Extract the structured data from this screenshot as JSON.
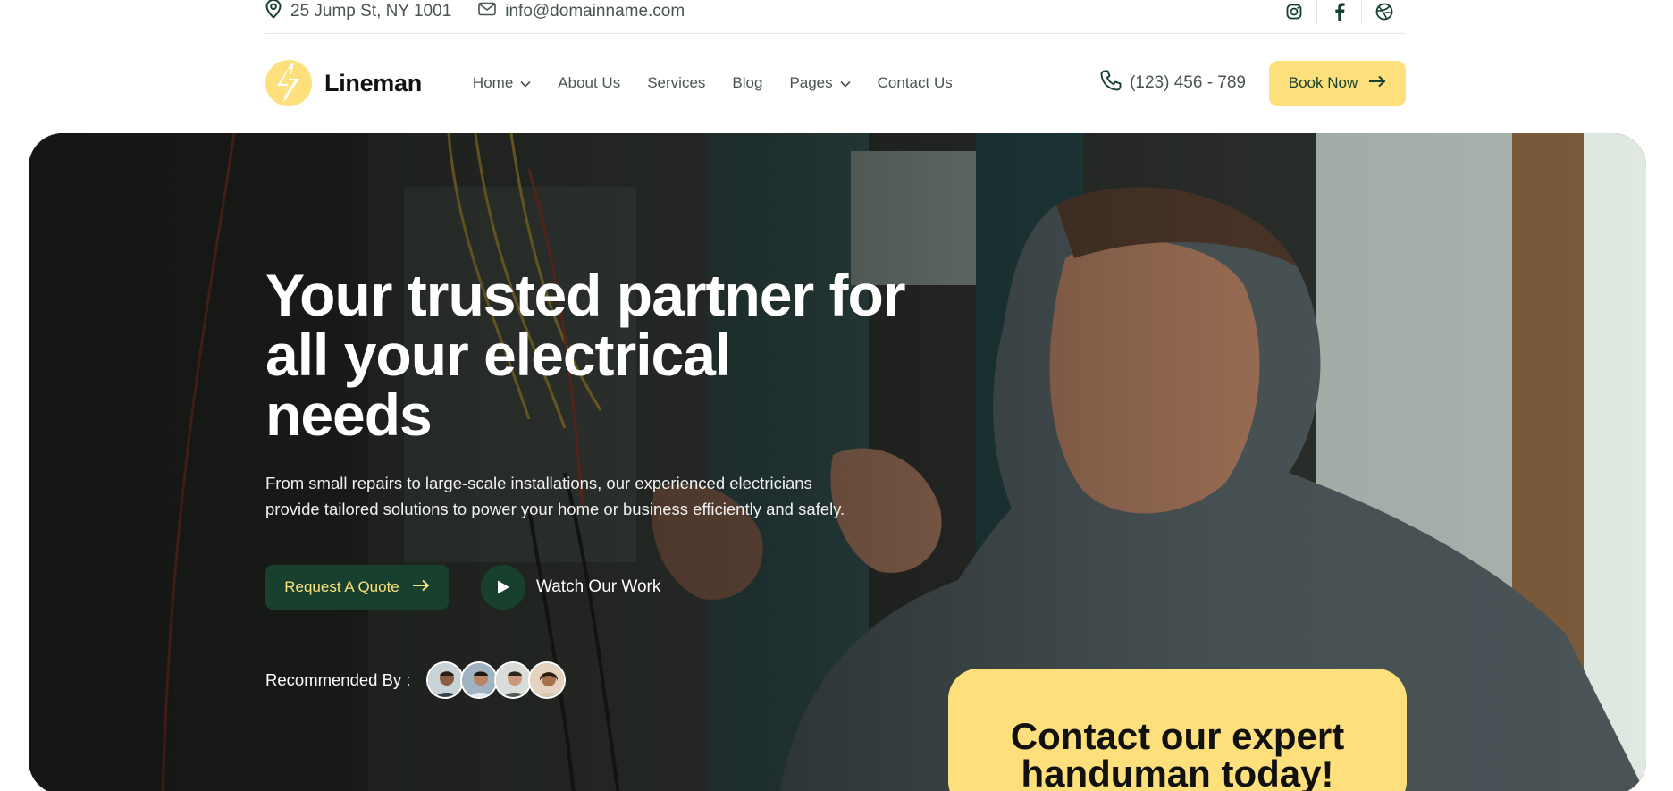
{
  "topbar": {
    "address": "25 Jump St, NY 1001",
    "email": "info@domainname.com",
    "socials": [
      "instagram-icon",
      "facebook-icon",
      "dribbble-icon"
    ]
  },
  "header": {
    "logo_text": "Lineman",
    "nav": [
      {
        "label": "Home",
        "has_dropdown": true
      },
      {
        "label": "About Us",
        "has_dropdown": false
      },
      {
        "label": "Services",
        "has_dropdown": false
      },
      {
        "label": "Blog",
        "has_dropdown": false
      },
      {
        "label": "Pages",
        "has_dropdown": true
      },
      {
        "label": "Contact Us",
        "has_dropdown": false
      }
    ],
    "phone": "(123) 456 - 789",
    "book_label": "Book Now"
  },
  "hero": {
    "title_line1": "Your trusted partner for",
    "title_line2": "all your electrical needs",
    "description": "From small repairs to large-scale installations, our experienced electricians provide tailored solutions to power your home or business efficiently and safely.",
    "quote_label": "Request A Quote",
    "watch_label": "Watch Our Work",
    "recommended_label": "Recommended By :",
    "avatar_count": 4
  },
  "contact_card": {
    "line1": "Contact our expert",
    "line2": "handuman today!"
  },
  "colors": {
    "brand_green": "#17402f",
    "brand_yellow": "#fde07c",
    "text_muted": "#4a5550"
  }
}
